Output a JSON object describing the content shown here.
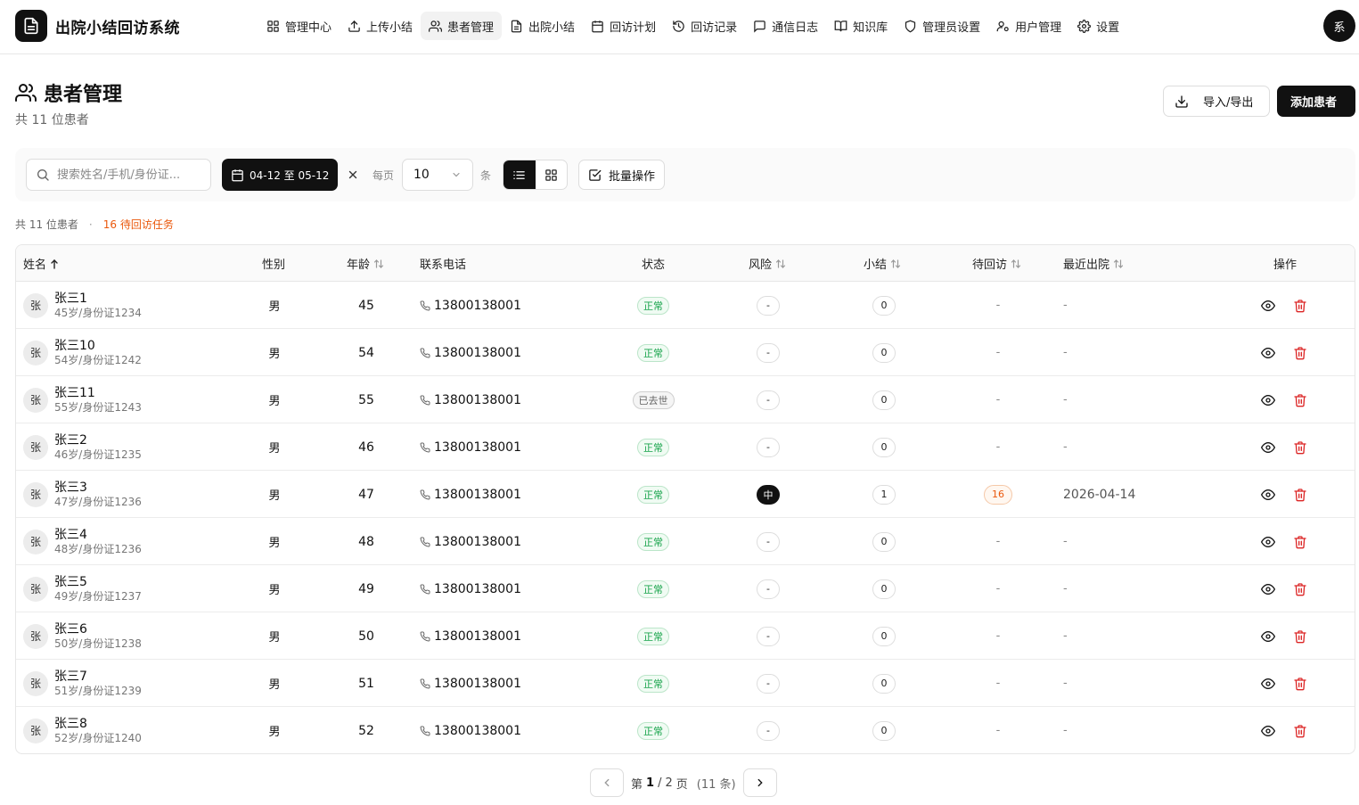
{
  "app": {
    "title": "出院小结回访系统",
    "user_avatar": "系"
  },
  "nav": [
    {
      "label": "管理中心",
      "icon": "grid-icon"
    },
    {
      "label": "上传小结",
      "icon": "upload-icon"
    },
    {
      "label": "患者管理",
      "icon": "users-icon",
      "active": true
    },
    {
      "label": "出院小结",
      "icon": "file-text-icon"
    },
    {
      "label": "回访计划",
      "icon": "calendar-icon"
    },
    {
      "label": "回访记录",
      "icon": "history-icon"
    },
    {
      "label": "通信日志",
      "icon": "message-icon"
    },
    {
      "label": "知识库",
      "icon": "book-icon"
    },
    {
      "label": "管理员设置",
      "icon": "shield-icon"
    },
    {
      "label": "用户管理",
      "icon": "user-cog-icon"
    },
    {
      "label": "设置",
      "icon": "gear-icon"
    }
  ],
  "page": {
    "title": "患者管理",
    "subtitle": "共 11 位患者",
    "import_export_label": "导入/导出",
    "add_patient_label": "添加患者"
  },
  "filters": {
    "search_placeholder": "搜索姓名/手机/身份证...",
    "date_range": "04-12 至 05-12",
    "per_page_label": "每页",
    "per_page_value": "10",
    "per_page_unit": "条",
    "batch_label": "批量操作"
  },
  "summary": {
    "count_text": "共 11 位患者",
    "separator": "·",
    "pending_text": "16 待回访任务"
  },
  "table": {
    "columns": {
      "name": "姓名",
      "gender": "性别",
      "age": "年龄",
      "phone": "联系电话",
      "status": "状态",
      "risk": "风险",
      "summaries": "小结",
      "pending": "待回访",
      "discharge": "最近出院",
      "actions": "操作"
    },
    "rows": [
      {
        "avatar": "张",
        "name": "张三1",
        "meta": "45岁/身份证1234",
        "gender": "男",
        "age": "45",
        "phone": "13800138001",
        "status": "正常",
        "status_type": "ok",
        "risk": "-",
        "summaries": "0",
        "pending": "-",
        "discharge": "-"
      },
      {
        "avatar": "张",
        "name": "张三10",
        "meta": "54岁/身份证1242",
        "gender": "男",
        "age": "54",
        "phone": "13800138001",
        "status": "正常",
        "status_type": "ok",
        "risk": "-",
        "summaries": "0",
        "pending": "-",
        "discharge": "-"
      },
      {
        "avatar": "张",
        "name": "张三11",
        "meta": "55岁/身份证1243",
        "gender": "男",
        "age": "55",
        "phone": "13800138001",
        "status": "已去世",
        "status_type": "dead",
        "risk": "-",
        "summaries": "0",
        "pending": "-",
        "discharge": "-"
      },
      {
        "avatar": "张",
        "name": "张三2",
        "meta": "46岁/身份证1235",
        "gender": "男",
        "age": "46",
        "phone": "13800138001",
        "status": "正常",
        "status_type": "ok",
        "risk": "-",
        "summaries": "0",
        "pending": "-",
        "discharge": "-"
      },
      {
        "avatar": "张",
        "name": "张三3",
        "meta": "47岁/身份证1236",
        "gender": "男",
        "age": "47",
        "phone": "13800138001",
        "status": "正常",
        "status_type": "ok",
        "risk": "中",
        "risk_type": "mid",
        "summaries": "1",
        "pending": "16",
        "discharge": "2026-04-14"
      },
      {
        "avatar": "张",
        "name": "张三4",
        "meta": "48岁/身份证1236",
        "gender": "男",
        "age": "48",
        "phone": "13800138001",
        "status": "正常",
        "status_type": "ok",
        "risk": "-",
        "summaries": "0",
        "pending": "-",
        "discharge": "-"
      },
      {
        "avatar": "张",
        "name": "张三5",
        "meta": "49岁/身份证1237",
        "gender": "男",
        "age": "49",
        "phone": "13800138001",
        "status": "正常",
        "status_type": "ok",
        "risk": "-",
        "summaries": "0",
        "pending": "-",
        "discharge": "-"
      },
      {
        "avatar": "张",
        "name": "张三6",
        "meta": "50岁/身份证1238",
        "gender": "男",
        "age": "50",
        "phone": "13800138001",
        "status": "正常",
        "status_type": "ok",
        "risk": "-",
        "summaries": "0",
        "pending": "-",
        "discharge": "-"
      },
      {
        "avatar": "张",
        "name": "张三7",
        "meta": "51岁/身份证1239",
        "gender": "男",
        "age": "51",
        "phone": "13800138001",
        "status": "正常",
        "status_type": "ok",
        "risk": "-",
        "summaries": "0",
        "pending": "-",
        "discharge": "-"
      },
      {
        "avatar": "张",
        "name": "张三8",
        "meta": "52岁/身份证1240",
        "gender": "男",
        "age": "52",
        "phone": "13800138001",
        "status": "正常",
        "status_type": "ok",
        "risk": "-",
        "summaries": "0",
        "pending": "-",
        "discharge": "-"
      }
    ]
  },
  "pagination": {
    "prefix": "第",
    "current": "1",
    "sep": "/",
    "total_pages": "2",
    "suffix": "页",
    "total": "(11 条)"
  },
  "colors": {
    "accent": "#111111",
    "ok": "#16a34a",
    "warn": "#ea580c",
    "danger": "#dc2626"
  }
}
